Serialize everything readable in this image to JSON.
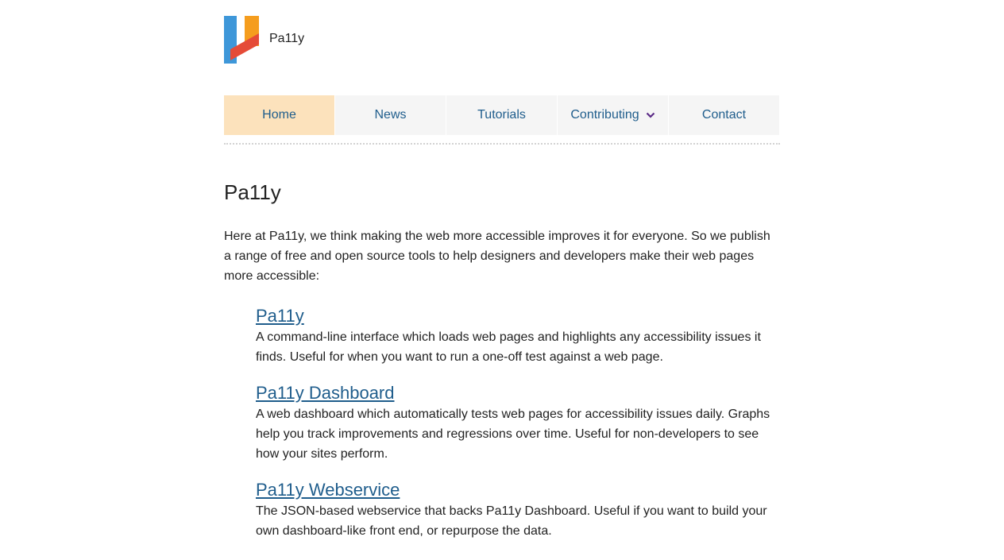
{
  "site": {
    "name": "Pa11y",
    "colors": {
      "logo_blue": "#3e97d9",
      "logo_orange": "#f59d1e",
      "logo_red": "#e54b38",
      "link": "#1f5d8c",
      "nav_active_bg": "#fce2bc",
      "nav_bg": "#f5f5f5",
      "chevron": "#5b2a86"
    }
  },
  "nav": {
    "items": [
      {
        "label": "Home",
        "active": true
      },
      {
        "label": "News"
      },
      {
        "label": "Tutorials"
      },
      {
        "label": "Contributing",
        "icon": "chevron-down-icon"
      },
      {
        "label": "Contact"
      }
    ]
  },
  "main": {
    "title": "Pa11y",
    "intro": "Here at Pa11y, we think making the web more accessible improves it for everyone. So we publish a range of free and open source tools to help designers and developers make their web pages more accessible:",
    "projects": [
      {
        "name": "Pa11y",
        "description": "A command-line interface which loads web pages and highlights any accessibility issues it finds. Useful for when you want to run a one-off test against a web page."
      },
      {
        "name": "Pa11y Dashboard",
        "description": "A web dashboard which automatically tests web pages for accessibility issues daily. Graphs help you track improvements and regressions over time. Useful for non-developers to see how your sites perform."
      },
      {
        "name": "Pa11y Webservice",
        "description": "The JSON-based webservice that backs Pa11y Dashboard. Useful if you want to build your own dashboard-like front end, or repurpose the data."
      }
    ]
  }
}
